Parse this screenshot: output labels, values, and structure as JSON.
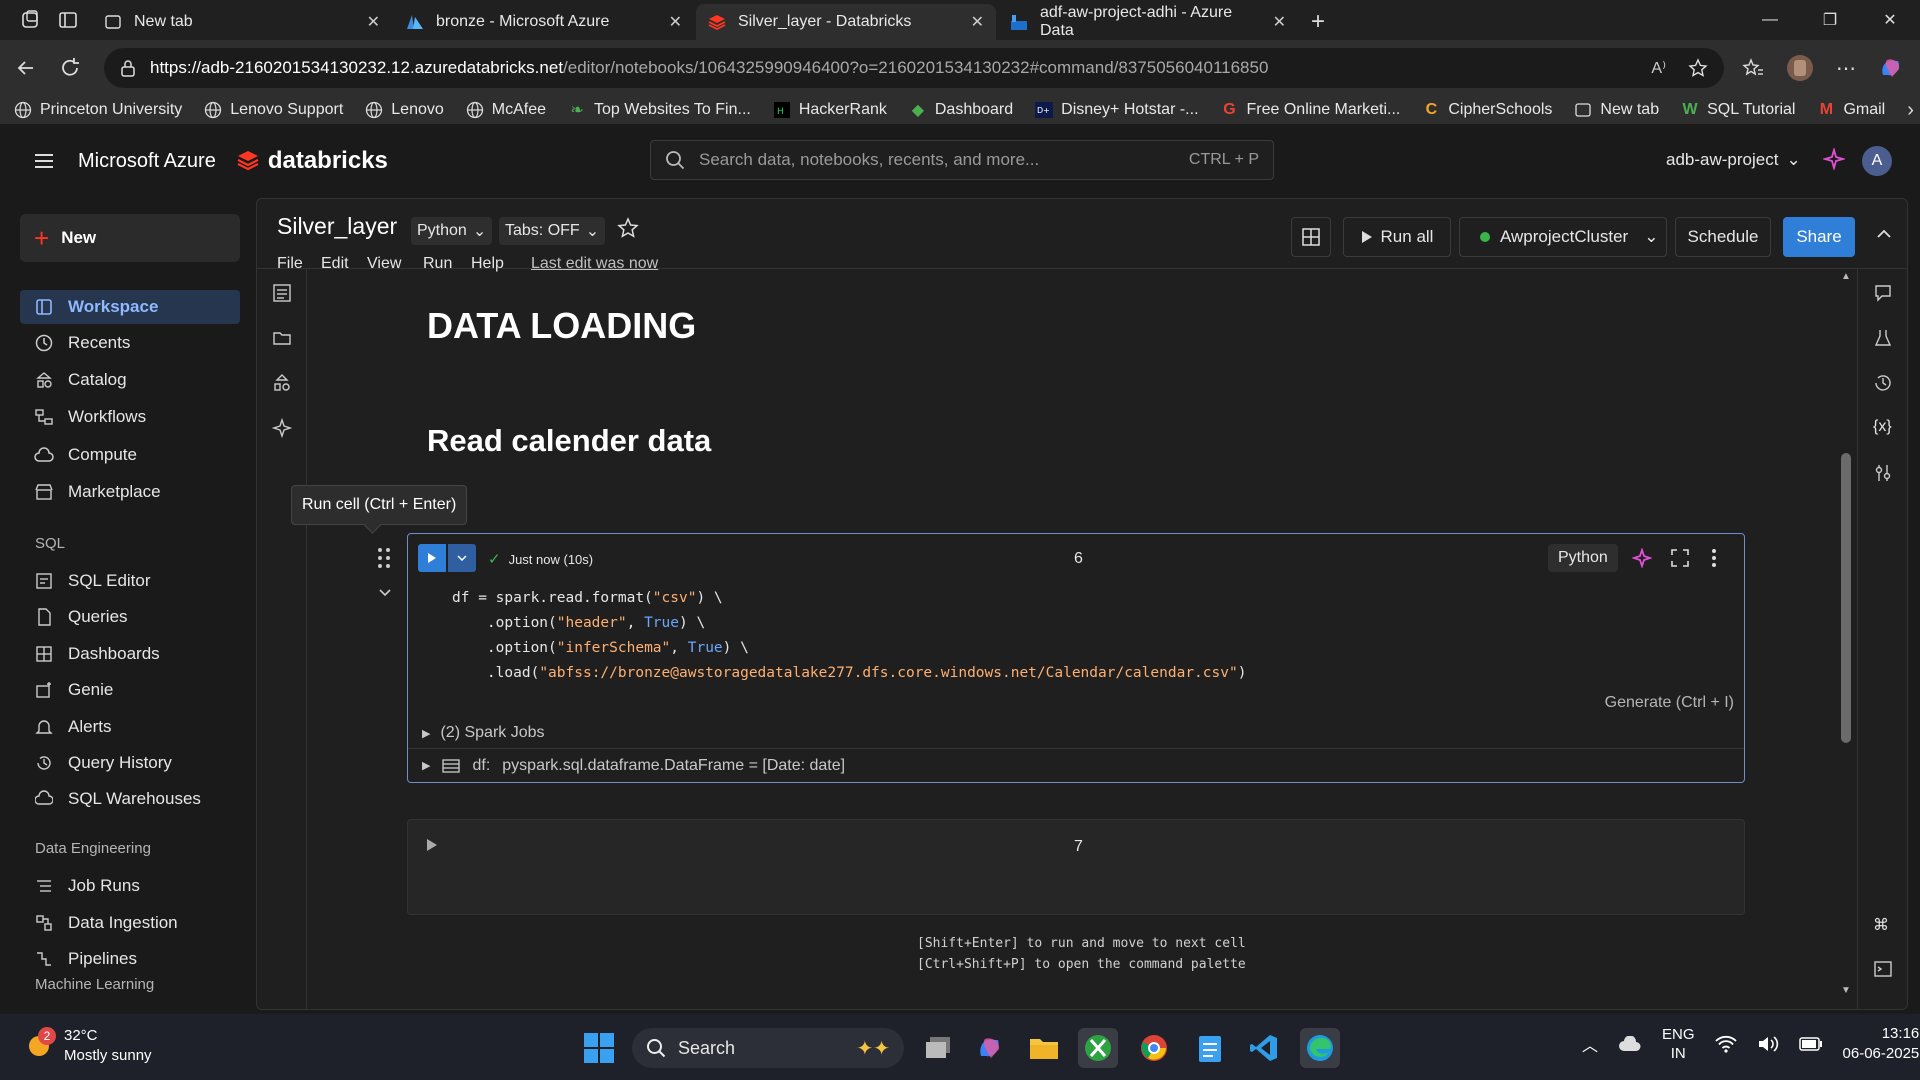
{
  "browser": {
    "tabs": [
      {
        "title": "New tab"
      },
      {
        "title": "bronze - Microsoft Azure"
      },
      {
        "title": "Silver_layer - Databricks"
      },
      {
        "title": "adf-aw-project-adhi - Azure Data"
      }
    ],
    "url_host": "https://adb-2160201534130232.12.azuredatabricks.net",
    "url_path": "/editor/notebooks/1064325990946400?o=2160201534130232#command/8375056040116850",
    "bookmarks": [
      {
        "label": "Princeton University"
      },
      {
        "label": "Lenovo Support"
      },
      {
        "label": "Lenovo"
      },
      {
        "label": "McAfee"
      },
      {
        "label": "Top Websites To Fin..."
      },
      {
        "label": "HackerRank"
      },
      {
        "label": "Dashboard"
      },
      {
        "label": "Disney+ Hotstar -..."
      },
      {
        "label": "Free Online Marketi..."
      },
      {
        "label": "CipherSchools"
      },
      {
        "label": "New tab"
      },
      {
        "label": "SQL Tutorial"
      },
      {
        "label": "Gmail"
      }
    ]
  },
  "topnav": {
    "azure": "Microsoft Azure",
    "databricks": "databricks",
    "search_placeholder": "Search data, notebooks, recents, and more...",
    "search_shortcut": "CTRL + P",
    "workspace": "adb-aw-project",
    "avatar": "A"
  },
  "sidebar": {
    "new_label": "New",
    "items": [
      {
        "label": "Workspace"
      },
      {
        "label": "Recents"
      },
      {
        "label": "Catalog"
      },
      {
        "label": "Workflows"
      },
      {
        "label": "Compute"
      },
      {
        "label": "Marketplace"
      }
    ],
    "sql_heading": "SQL",
    "sql_items": [
      {
        "label": "SQL Editor"
      },
      {
        "label": "Queries"
      },
      {
        "label": "Dashboards"
      },
      {
        "label": "Genie"
      },
      {
        "label": "Alerts"
      },
      {
        "label": "Query History"
      },
      {
        "label": "SQL Warehouses"
      }
    ],
    "de_heading": "Data Engineering",
    "de_items": [
      {
        "label": "Job Runs"
      },
      {
        "label": "Data Ingestion"
      },
      {
        "label": "Pipelines"
      }
    ],
    "ml_heading": "Machine Learning"
  },
  "notebook": {
    "title": "Silver_layer",
    "language": "Python",
    "tabs_setting": "Tabs: OFF",
    "menus": [
      "File",
      "Edit",
      "View",
      "Run",
      "Help"
    ],
    "last_edit": "Last edit was now",
    "run_all": "Run all",
    "cluster": "AwprojectCluster",
    "schedule": "Schedule",
    "share": "Share",
    "heading1": "DATA LOADING",
    "heading2": "Read calender data",
    "tooltip": "Run cell (Ctrl + Enter)",
    "cell6": {
      "status": "Just now (10s)",
      "number": "6",
      "lang": "Python",
      "generate": "Generate (Ctrl + I)",
      "jobs": "(2) Spark Jobs",
      "df_name": "df:",
      "df_type": "pyspark.sql.dataframe.DataFrame = [Date: date]",
      "code": {
        "l1a": "df = spark.read.format(",
        "l1s": "\"csv\"",
        "l1b": ") \\",
        "l2a": "    .option(",
        "l2s": "\"header\"",
        "l2b": ", ",
        "l2k": "True",
        "l2c": ") \\",
        "l3a": "    .option(",
        "l3s": "\"inferSchema\"",
        "l3b": ", ",
        "l3k": "True",
        "l3c": ") \\",
        "l4a": "    .load(",
        "l4s": "\"abfss://bronze@awstoragedatalake277.dfs.core.windows.net/Calendar/calendar.csv\"",
        "l4b": ")"
      }
    },
    "cell7": {
      "number": "7"
    },
    "hints": [
      "[Shift+Enter] to run and move to next cell",
      "[Ctrl+Shift+P] to open the command palette"
    ]
  },
  "taskbar": {
    "weather_badge": "2",
    "temp": "32°C",
    "condition": "Mostly sunny",
    "search": "Search",
    "lang1": "ENG",
    "lang2": "IN",
    "time": "13:16",
    "date": "06-06-2025"
  },
  "colors": {
    "accent": "#2f7ed8",
    "cluster_ok": "#3bb54a",
    "brand": "#ff3621"
  }
}
